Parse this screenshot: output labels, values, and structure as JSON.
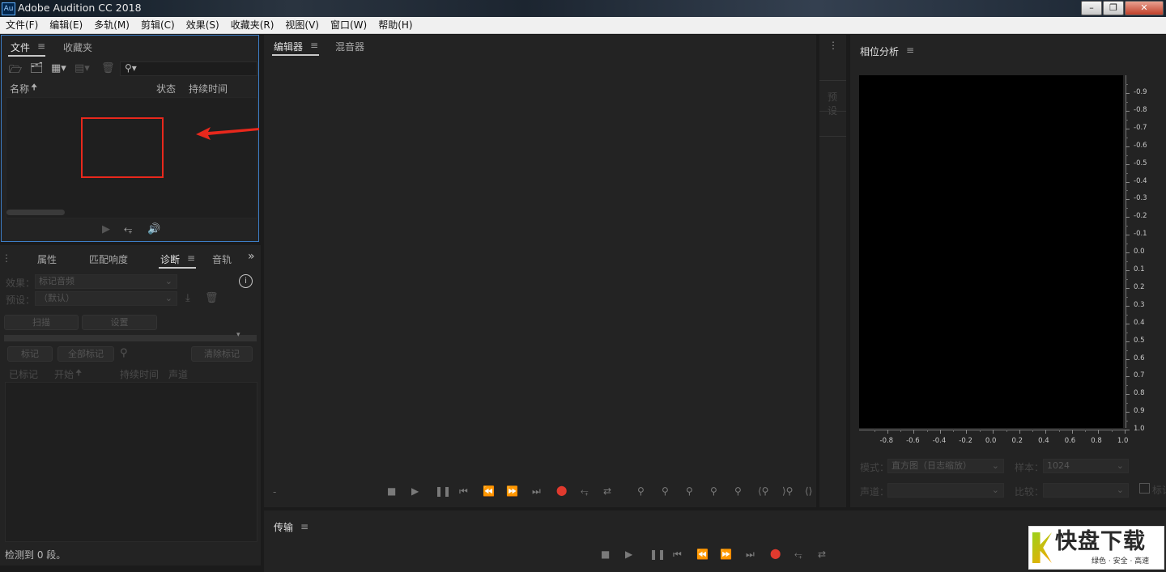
{
  "window": {
    "title": "Adobe Audition CC 2018",
    "icon_text": "Au"
  },
  "menu": [
    "文件(F)",
    "编辑(E)",
    "多轨(M)",
    "剪辑(C)",
    "效果(S)",
    "收藏夹(R)",
    "视图(V)",
    "窗口(W)",
    "帮助(H)"
  ],
  "files_panel": {
    "tabs": [
      "文件",
      "收藏夹"
    ],
    "columns": {
      "name": "名称",
      "status": "状态",
      "duration": "持续时间"
    },
    "search_placeholder": ""
  },
  "lower_left": {
    "tabs": [
      "属性",
      "匹配响度",
      "诊断",
      "音轨"
    ],
    "effect_label": "效果：",
    "effect_value": "标记音频",
    "preset_label": "预设：",
    "preset_value": "（默认）",
    "scan_button": "扫描",
    "settings_button": "设置",
    "mark_button": "标记",
    "mark_all_button": "全部标记",
    "clear_marks_button": "清除标记",
    "columns": [
      "已标记",
      "开始",
      "持续时间",
      "声道"
    ],
    "status_text": "检测到 0 段。"
  },
  "editor": {
    "tabs": [
      "编辑器",
      "混音器"
    ],
    "time_placeholder": "-"
  },
  "presets_strip": {
    "label": "预设"
  },
  "transport": {
    "title": "传输"
  },
  "phase_analysis": {
    "title": "相位分析",
    "y_ticks": [
      "-0.9",
      "-0.8",
      "-0.7",
      "-0.6",
      "-0.5",
      "-0.4",
      "-0.3",
      "-0.2",
      "-0.1",
      "0.0",
      "0.1",
      "0.2",
      "0.3",
      "0.4",
      "0.5",
      "0.6",
      "0.7",
      "0.8",
      "0.9",
      "1.0"
    ],
    "x_ticks": [
      "-0.8",
      "-0.6",
      "-0.4",
      "-0.2",
      "0.0",
      "0.2",
      "0.4",
      "0.6",
      "0.8",
      "1.0"
    ],
    "mode_label": "模式：",
    "mode_value": "直方图（日志缩放）",
    "samples_label": "样本：",
    "samples_value": "1024",
    "channel_label": "声道：",
    "compare_label": "比较：",
    "checkbox_label": "标记"
  },
  "watermark": {
    "big": "快盘下载",
    "small": "绿色 · 安全 · 高速"
  },
  "colors": {
    "accent_blue": "#3d7ec7",
    "record_red": "#e03a2e",
    "annotation_red": "#e8281c"
  }
}
